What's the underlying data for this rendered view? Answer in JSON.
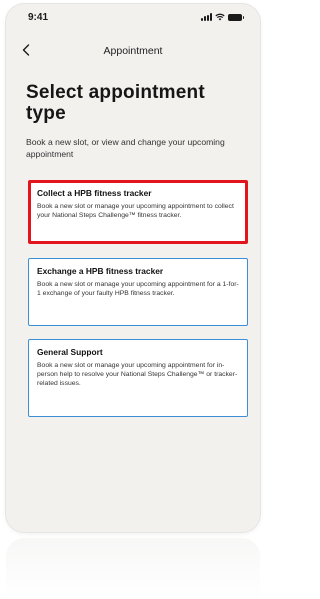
{
  "status_bar": {
    "time": "9:41",
    "icons": [
      "signal-icon",
      "wifi-icon",
      "battery-icon"
    ]
  },
  "nav": {
    "back_icon": "chevron-left-icon",
    "title": "Appointment"
  },
  "header": {
    "title": "Select appointment type",
    "subtitle": "Book a new slot, or view and change your upcoming appointment"
  },
  "options": [
    {
      "title": "Collect a HPB fitness tracker",
      "description": "Book a new slot or manage your upcoming appointment to collect your National Steps Challenge™ fitness tracker.",
      "selected": true
    },
    {
      "title": "Exchange a HPB fitness tracker",
      "description": "Book a new slot or manage your upcoming appointment for a 1-for-1 exchange of your faulty HPB fitness tracker.",
      "selected": false
    },
    {
      "title": "General Support",
      "description": "Book a new slot or manage your upcoming appointment for in-person help to resolve your National Steps Challenge™ or tracker-related issues.",
      "selected": false
    }
  ],
  "colors": {
    "background": "#f2f1ee",
    "card_border": "#3c8fd6",
    "selected_border": "#e3141b",
    "text": "#161616"
  }
}
